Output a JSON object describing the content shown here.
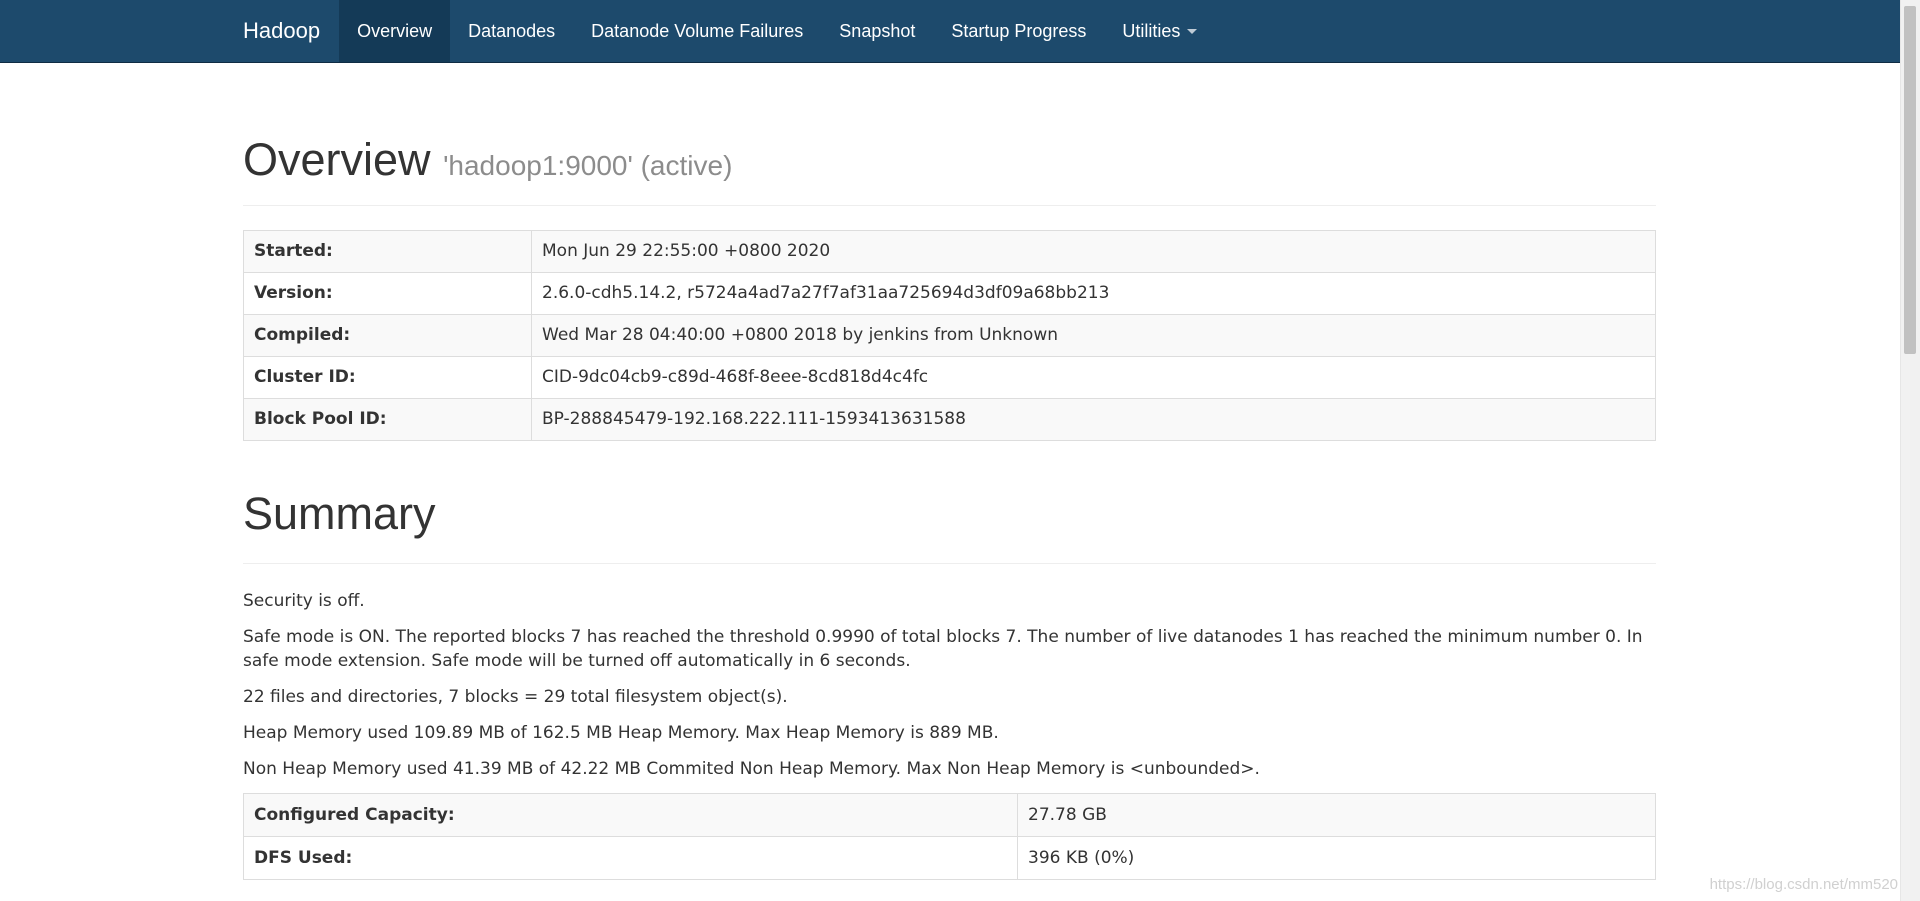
{
  "navbar": {
    "brand": "Hadoop",
    "items": [
      {
        "label": "Overview"
      },
      {
        "label": "Datanodes"
      },
      {
        "label": "Datanode Volume Failures"
      },
      {
        "label": "Snapshot"
      },
      {
        "label": "Startup Progress"
      },
      {
        "label": "Utilities"
      }
    ]
  },
  "overview": {
    "title": "Overview",
    "subtitle": "'hadoop1:9000' (active)",
    "rows": [
      {
        "key": "Started:",
        "value": "Mon Jun 29 22:55:00 +0800 2020"
      },
      {
        "key": "Version:",
        "value": "2.6.0-cdh5.14.2, r5724a4ad7a27f7af31aa725694d3df09a68bb213"
      },
      {
        "key": "Compiled:",
        "value": "Wed Mar 28 04:40:00 +0800 2018 by jenkins from Unknown"
      },
      {
        "key": "Cluster ID:",
        "value": "CID-9dc04cb9-c89d-468f-8eee-8cd818d4c4fc"
      },
      {
        "key": "Block Pool ID:",
        "value": "BP-288845479-192.168.222.111-1593413631588"
      }
    ]
  },
  "summary": {
    "title": "Summary",
    "lines": [
      "Security is off.",
      "Safe mode is ON. The reported blocks 7 has reached the threshold 0.9990 of total blocks 7. The number of live datanodes 1 has reached the minimum number 0. In safe mode extension. Safe mode will be turned off automatically in 6 seconds.",
      "22 files and directories, 7 blocks = 29 total filesystem object(s).",
      "Heap Memory used 109.89 MB of 162.5 MB Heap Memory. Max Heap Memory is 889 MB.",
      "Non Heap Memory used 41.39 MB of 42.22 MB Commited Non Heap Memory. Max Non Heap Memory is <unbounded>."
    ],
    "rows": [
      {
        "key": "Configured Capacity:",
        "value": "27.78 GB"
      },
      {
        "key": "DFS Used:",
        "value": "396 KB (0%)"
      }
    ]
  },
  "watermark": "https://blog.csdn.net/mm520"
}
